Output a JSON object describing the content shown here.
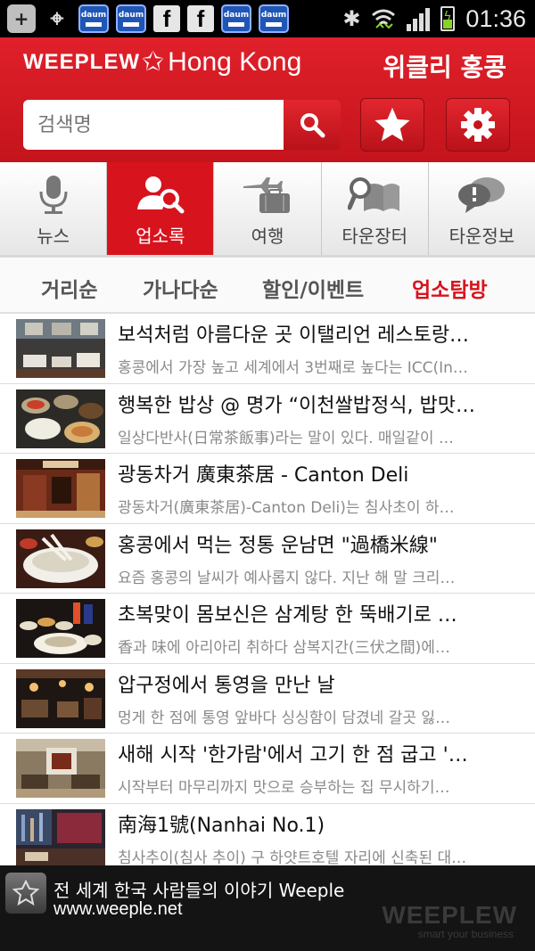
{
  "status_bar": {
    "time": "01:36",
    "daum_label": "daum",
    "facebook_label": "f"
  },
  "header": {
    "brand_logo": "WEEPLEW",
    "brand_city": "Hong Kong",
    "weekly_title": "위클리 홍콩",
    "search_placeholder": "검색명"
  },
  "tabs": [
    {
      "label": "뉴스",
      "icon": "microphone-icon",
      "active": false
    },
    {
      "label": "업소록",
      "icon": "person-search-icon",
      "active": true
    },
    {
      "label": "여행",
      "icon": "plane-luggage-icon",
      "active": false
    },
    {
      "label": "타운장터",
      "icon": "book-search-icon",
      "active": false
    },
    {
      "label": "타운정보",
      "icon": "chat-bubbles-icon",
      "active": false
    }
  ],
  "sort_options": [
    {
      "label": "거리순",
      "active": false
    },
    {
      "label": "가나다순",
      "active": false
    },
    {
      "label": "할인/이벤트",
      "active": false
    },
    {
      "label": "업소탐방",
      "active": true
    }
  ],
  "list": [
    {
      "title": "보석처럼 아름다운 곳 이탤리언 레스토랑…",
      "subtitle": "홍콩에서 가장 높고 세계에서 3번째로 높다는 ICC(In…"
    },
    {
      "title": "행복한 밥상 @ 명가 “이천쌀밥정식, 밥맛…",
      "subtitle": "일상다반사(日常茶飯事)라는 말이 있다. 매일같이 …"
    },
    {
      "title": "광동차거 廣東茶居 - Canton Deli",
      "subtitle": "광동차거(廣東茶居)-Canton Deli)는 침사초이 하…"
    },
    {
      "title": "홍콩에서 먹는 정통 운남면 \"過橋米線\"",
      "subtitle": "요즘 홍콩의 날씨가 예사롭지 않다. 지난 해 말 크리…"
    },
    {
      "title": "초복맞이 몸보신은 삼계탕 한 뚝배기로 …",
      "subtitle": "香과 味에 아리아리 취하다  삼복지간(三伏之間)에…"
    },
    {
      "title": "압구정에서 통영을 만난 날",
      "subtitle": "멍게 한 점에 통영 앞바다 싱싱함이 담겼네    갈곳 잃…"
    },
    {
      "title": "새해 시작 '한가람'에서 고기 한 점 굽고 '…",
      "subtitle": "시작부터 마무리까지 맛으로 승부하는 집    무시하기…"
    },
    {
      "title": "南海1號(Nanhai No.1)",
      "subtitle": "침사추이(침사 추이) 구 하얏트호텔 자리에 신축된 대…"
    }
  ],
  "footer": {
    "line1": "전 세계 한국 사람들의 이야기 Weeple",
    "line2": "www.weeple.net",
    "watermark": "WEEPLEW",
    "watermark_tagline": "smart your business"
  },
  "colors": {
    "brand_red": "#d7141d",
    "header_red": "#e0202a",
    "footer_bg": "#141414"
  }
}
